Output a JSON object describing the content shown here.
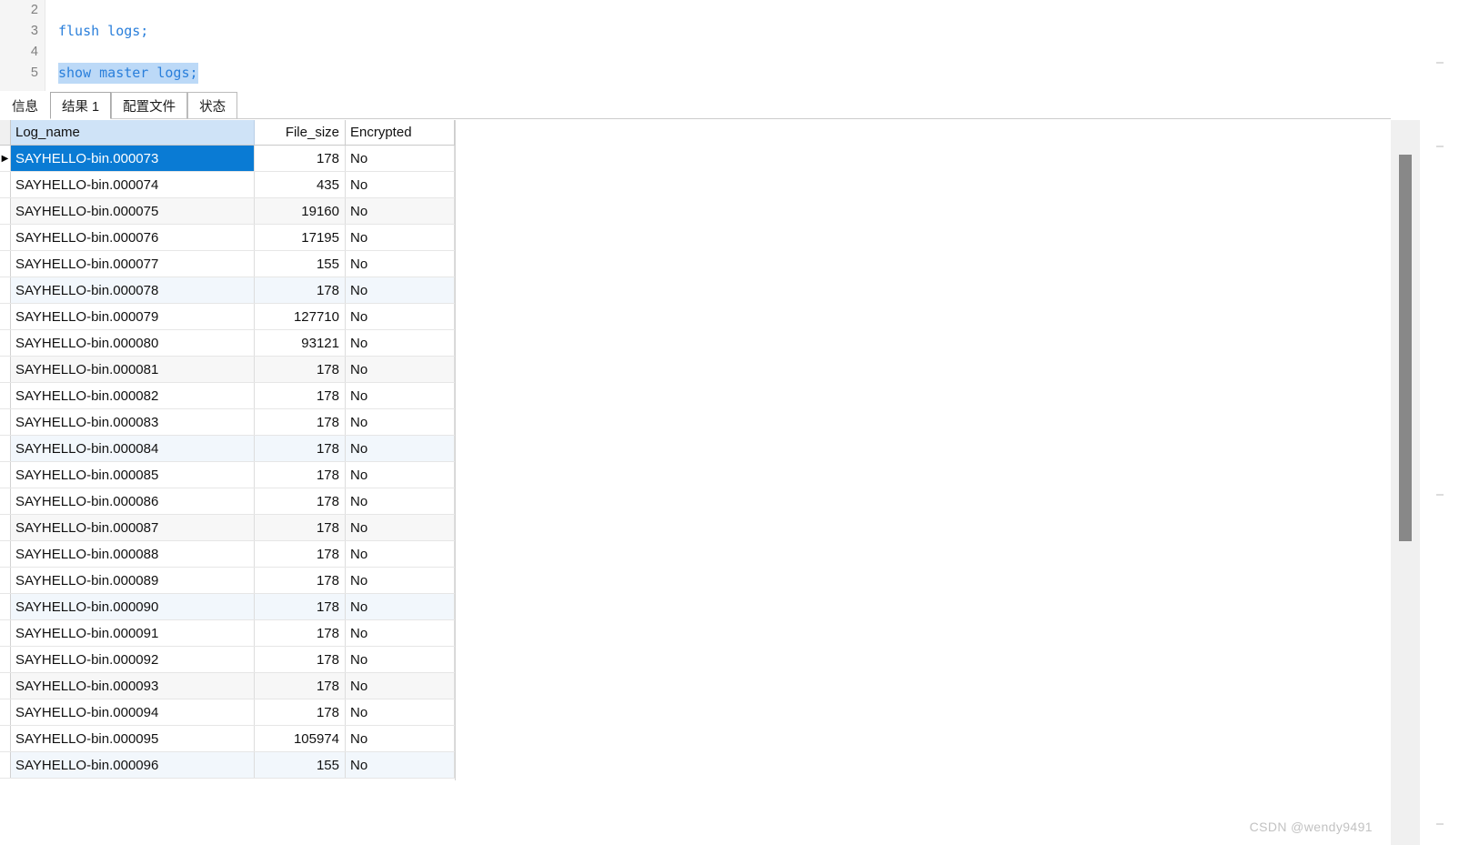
{
  "editor": {
    "lines": [
      {
        "number": "2",
        "text": "",
        "selected": false
      },
      {
        "number": "3",
        "text": "flush logs;",
        "selected": false
      },
      {
        "number": "4",
        "text": "",
        "selected": false
      },
      {
        "number": "5",
        "text": "show master logs;",
        "selected": true
      }
    ]
  },
  "tabs": [
    {
      "label": "信息",
      "active": false,
      "boxed": false
    },
    {
      "label": "结果 1",
      "active": true,
      "boxed": false
    },
    {
      "label": "配置文件",
      "active": false,
      "boxed": true
    },
    {
      "label": "状态",
      "active": false,
      "boxed": true
    }
  ],
  "grid": {
    "columns": [
      "Log_name",
      "File_size",
      "Encrypted"
    ],
    "selected_row_index": 0,
    "row_marker": "▶",
    "rows": [
      {
        "log_name": "SAYHELLO-bin.000073",
        "file_size": "178",
        "encrypted": "No"
      },
      {
        "log_name": "SAYHELLO-bin.000074",
        "file_size": "435",
        "encrypted": "No"
      },
      {
        "log_name": "SAYHELLO-bin.000075",
        "file_size": "19160",
        "encrypted": "No"
      },
      {
        "log_name": "SAYHELLO-bin.000076",
        "file_size": "17195",
        "encrypted": "No"
      },
      {
        "log_name": "SAYHELLO-bin.000077",
        "file_size": "155",
        "encrypted": "No"
      },
      {
        "log_name": "SAYHELLO-bin.000078",
        "file_size": "178",
        "encrypted": "No"
      },
      {
        "log_name": "SAYHELLO-bin.000079",
        "file_size": "127710",
        "encrypted": "No"
      },
      {
        "log_name": "SAYHELLO-bin.000080",
        "file_size": "93121",
        "encrypted": "No"
      },
      {
        "log_name": "SAYHELLO-bin.000081",
        "file_size": "178",
        "encrypted": "No"
      },
      {
        "log_name": "SAYHELLO-bin.000082",
        "file_size": "178",
        "encrypted": "No"
      },
      {
        "log_name": "SAYHELLO-bin.000083",
        "file_size": "178",
        "encrypted": "No"
      },
      {
        "log_name": "SAYHELLO-bin.000084",
        "file_size": "178",
        "encrypted": "No"
      },
      {
        "log_name": "SAYHELLO-bin.000085",
        "file_size": "178",
        "encrypted": "No"
      },
      {
        "log_name": "SAYHELLO-bin.000086",
        "file_size": "178",
        "encrypted": "No"
      },
      {
        "log_name": "SAYHELLO-bin.000087",
        "file_size": "178",
        "encrypted": "No"
      },
      {
        "log_name": "SAYHELLO-bin.000088",
        "file_size": "178",
        "encrypted": "No"
      },
      {
        "log_name": "SAYHELLO-bin.000089",
        "file_size": "178",
        "encrypted": "No"
      },
      {
        "log_name": "SAYHELLO-bin.000090",
        "file_size": "178",
        "encrypted": "No"
      },
      {
        "log_name": "SAYHELLO-bin.000091",
        "file_size": "178",
        "encrypted": "No"
      },
      {
        "log_name": "SAYHELLO-bin.000092",
        "file_size": "178",
        "encrypted": "No"
      },
      {
        "log_name": "SAYHELLO-bin.000093",
        "file_size": "178",
        "encrypted": "No"
      },
      {
        "log_name": "SAYHELLO-bin.000094",
        "file_size": "178",
        "encrypted": "No"
      },
      {
        "log_name": "SAYHELLO-bin.000095",
        "file_size": "105974",
        "encrypted": "No"
      },
      {
        "log_name": "SAYHELLO-bin.000096",
        "file_size": "155",
        "encrypted": "No"
      }
    ]
  },
  "watermark": {
    "text": "CSDN @wendy9491"
  },
  "colors": {
    "selection_blue": "#0a7bd4",
    "header_blue": "#cfe3f7",
    "code_keyword": "#2a7fdb",
    "code_selection": "#bcd9f7",
    "row_alt_gray": "#f7f7f7",
    "row_alt_blue": "#f2f7fc",
    "scrollbar_thumb": "#888888"
  }
}
